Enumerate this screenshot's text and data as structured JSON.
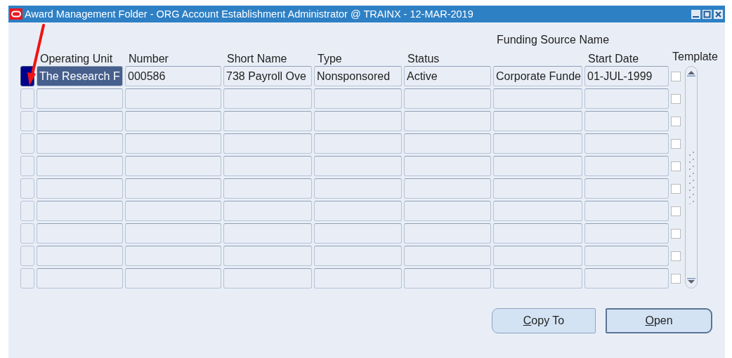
{
  "window": {
    "title": "Award Management Folder - ORG Account Establishment Administrator @ TRAINX - 12-MAR-2019"
  },
  "table": {
    "group_heading": "Funding Source Name",
    "columns": [
      "Operating Unit",
      "Number",
      "Short Name",
      "Type",
      "Status",
      "",
      "Start Date",
      "Template"
    ],
    "rows": [
      {
        "selected": true,
        "template_checked": false,
        "cells": [
          "The Research F",
          "000586",
          "738 Payroll Ove",
          "Nonsponsored",
          "Active",
          "Corporate Funde",
          "01-JUL-1999"
        ]
      },
      {
        "selected": false,
        "template_checked": false,
        "cells": []
      },
      {
        "selected": false,
        "template_checked": false,
        "cells": []
      },
      {
        "selected": false,
        "template_checked": false,
        "cells": []
      },
      {
        "selected": false,
        "template_checked": false,
        "cells": []
      },
      {
        "selected": false,
        "template_checked": false,
        "cells": []
      },
      {
        "selected": false,
        "template_checked": false,
        "cells": []
      },
      {
        "selected": false,
        "template_checked": false,
        "cells": []
      },
      {
        "selected": false,
        "template_checked": false,
        "cells": []
      },
      {
        "selected": false,
        "template_checked": false,
        "cells": []
      }
    ]
  },
  "buttons": [
    {
      "label": "Copy To",
      "default": false
    },
    {
      "label": "Open",
      "default": true
    }
  ]
}
